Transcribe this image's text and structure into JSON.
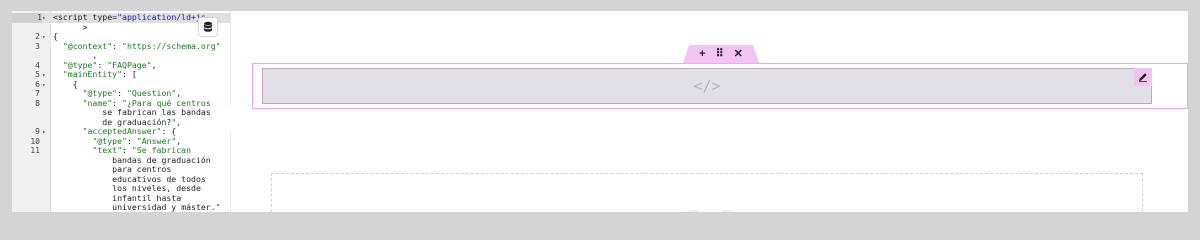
{
  "editor": {
    "lines": [
      {
        "num": "1",
        "fold": true,
        "text": "<script type=\"application/ld+js",
        "active": true
      },
      {
        "num": "",
        "fold": false,
        "text": "      >"
      },
      {
        "num": "2",
        "fold": true,
        "text": "{"
      },
      {
        "num": "3",
        "fold": false,
        "text": "  \"@context\": \"https://schema.org\""
      },
      {
        "num": "",
        "fold": false,
        "text": "        ,"
      },
      {
        "num": "4",
        "fold": false,
        "text": "  \"@type\": \"FAQPage\","
      },
      {
        "num": "5",
        "fold": true,
        "text": "  \"mainEntity\": ["
      },
      {
        "num": "6",
        "fold": true,
        "text": "    {"
      },
      {
        "num": "7",
        "fold": false,
        "text": "      \"@type\": \"Question\","
      },
      {
        "num": "8",
        "fold": false,
        "text": "      \"name\": \"¿Para qué centros"
      },
      {
        "num": "",
        "fold": false,
        "text": "          se fabrican las bandas"
      },
      {
        "num": "",
        "fold": false,
        "text": "          de graduación?\","
      },
      {
        "num": "9",
        "fold": true,
        "text": "      \"acceptedAnswer\": {"
      },
      {
        "num": "10",
        "fold": false,
        "text": "        \"@type\": \"Answer\","
      },
      {
        "num": "11",
        "fold": false,
        "text": "        \"text\": \"Se fabrican"
      },
      {
        "num": "",
        "fold": false,
        "text": "            bandas de graduación"
      },
      {
        "num": "",
        "fold": false,
        "text": "            para centros"
      },
      {
        "num": "",
        "fold": false,
        "text": "            educativos de todos"
      },
      {
        "num": "",
        "fold": false,
        "text": "            los niveles, desde"
      },
      {
        "num": "",
        "fold": false,
        "text": "            infantil hasta"
      },
      {
        "num": "",
        "fold": false,
        "text": "            universidad y máster.\""
      }
    ],
    "collapse_glyph": "‹"
  },
  "canvas": {
    "toolbar": {
      "add": "+",
      "move": "⠿",
      "close": "✕"
    },
    "html_block_icon": "</>"
  },
  "colors": {
    "accent": "#f2c4f2",
    "outline": "#f0a8f0",
    "block": "#e0e0e6"
  }
}
